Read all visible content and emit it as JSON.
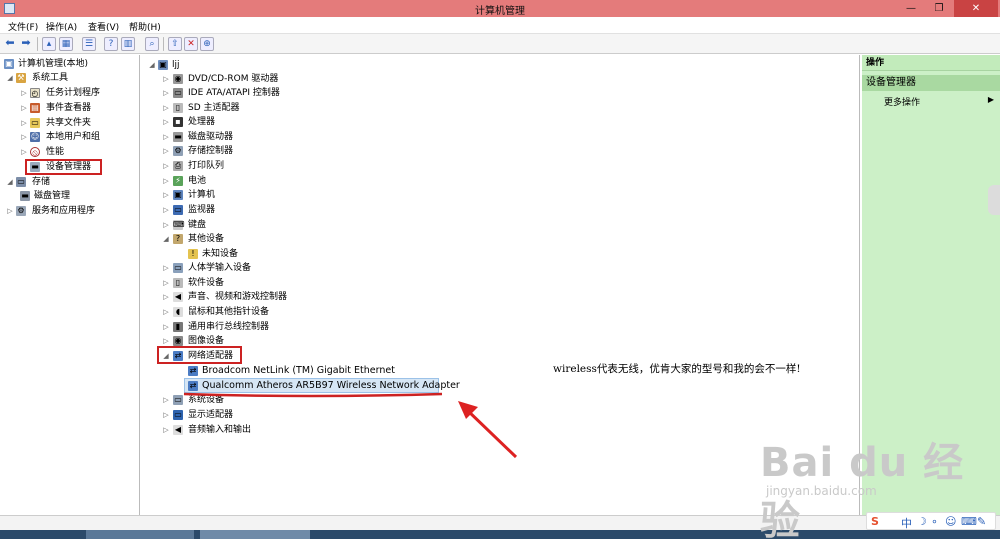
{
  "window": {
    "title": "计算机管理",
    "controls": [
      "—",
      "❐",
      "✕"
    ]
  },
  "menu": {
    "file": "文件(F)",
    "action": "操作(A)",
    "view": "查看(V)",
    "help": "帮助(H)"
  },
  "left_tree": {
    "root": "计算机管理(本地)",
    "system_tools": "系统工具",
    "task_scheduler": "任务计划程序",
    "event_viewer": "事件查看器",
    "shared_folders": "共享文件夹",
    "local_users": "本地用户和组",
    "performance": "性能",
    "device_manager": "设备管理器",
    "storage": "存储",
    "disk_management": "磁盘管理",
    "services_apps": "服务和应用程序"
  },
  "device_tree": {
    "root": "ljj",
    "categories": [
      "DVD/CD-ROM 驱动器",
      "IDE ATA/ATAPI 控制器",
      "SD 主适配器",
      "处理器",
      "磁盘驱动器",
      "存储控制器",
      "打印队列",
      "电池",
      "计算机",
      "监视器",
      "键盘",
      "其他设备",
      "未知设备",
      "人体学输入设备",
      "软件设备",
      "声音、视频和游戏控制器",
      "鼠标和其他指针设备",
      "通用串行总线控制器",
      "图像设备",
      "网络适配器",
      "Broadcom NetLink (TM) Gigabit Ethernet",
      "Qualcomm Atheros AR5B97 Wireless Network Adapter",
      "系统设备",
      "显示适配器",
      "音频输入和输出"
    ]
  },
  "actions_pane": {
    "header": "操作",
    "section": "设备管理器",
    "more": "更多操作"
  },
  "annotation": "wireless代表无线，优肯大家的型号和我的会不一样!",
  "watermark": {
    "brand": "Bai du 经验",
    "url": "jingyan.baidu.com"
  },
  "tray": {
    "lang": "中"
  },
  "colors": {
    "titlebar": "#e47b7b",
    "highlight": "#cc2222",
    "actions_pane": "#ccf0c7"
  }
}
